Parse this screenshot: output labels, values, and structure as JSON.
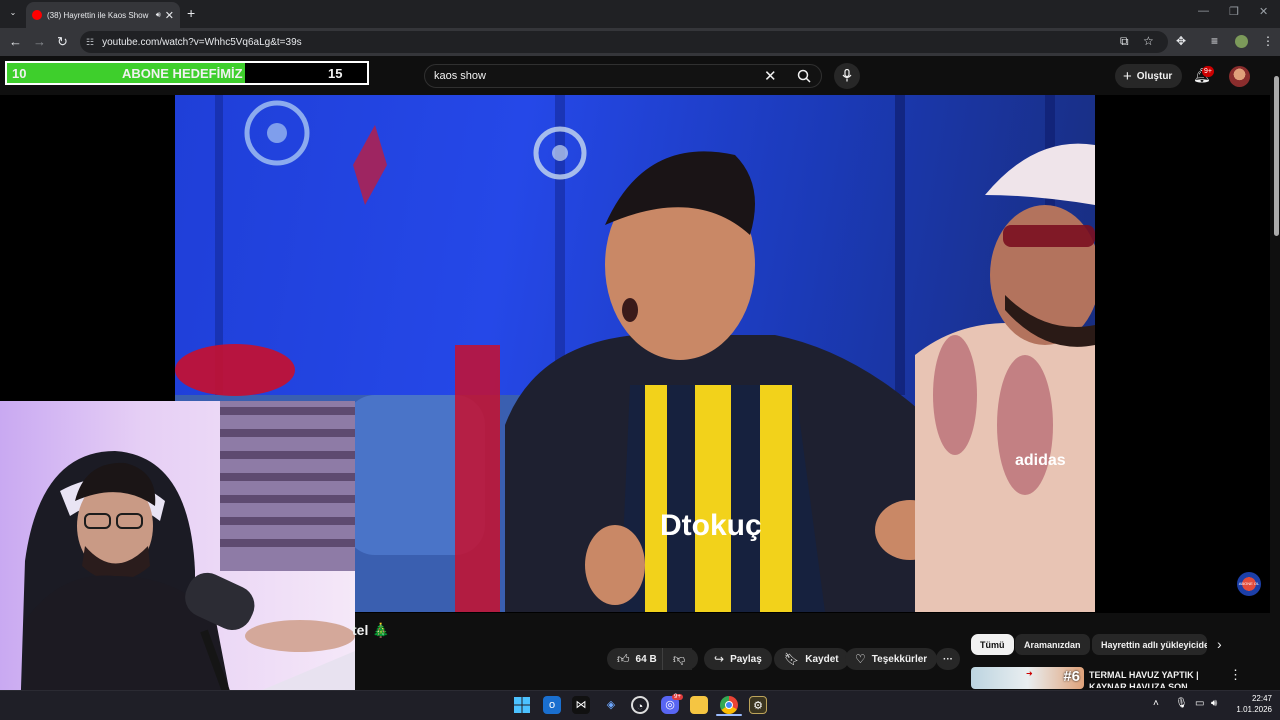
{
  "browser": {
    "tab_title": "(38) Hayrettin ile Kaos Show",
    "tab_audio_icon": "speaker-icon",
    "url": "youtube.com/watch?v=Whhc5Vq6aLg&t=39s"
  },
  "overlay": {
    "subscriber_goal": {
      "current": "10",
      "label": "ABONE HEDEFİMİZ",
      "target": "15",
      "progress_fraction": 0.66,
      "fill_color": "#3ecf2c"
    }
  },
  "youtube": {
    "search": {
      "value": "kaos show"
    },
    "header": {
      "create_label": "Oluştur",
      "notification_badge": "9+"
    },
    "video": {
      "title_visible_tail": "tel 🎄",
      "actions": {
        "likes": "64 B",
        "share": "Paylaş",
        "save": "Kaydet",
        "thanks": "Teşekkürler"
      }
    },
    "recommendations": {
      "chips": [
        "Tümü",
        "Aramanızdan",
        "Hayrettin adlı yükleyiciden"
      ],
      "active_chip": "Tümü",
      "items": [
        {
          "title": "TERMAL HAVUZ YAPTIK | KAYNAR HAVUZA SON DÜŞEN",
          "thumb_badge": "#6"
        }
      ]
    }
  },
  "video_frame": {
    "jersey_text": "Dtokuç",
    "cap_brand": "adidas",
    "channel_watermark": "ABONE OL"
  },
  "taskbar": {
    "time": "22:47",
    "date": "1.01.2026",
    "apps": [
      "windows-start-icon",
      "outlook-icon",
      "capcut-icon",
      "vpn-icon",
      "obs-icon",
      "discord-icon",
      "file-explorer-icon",
      "chrome-icon",
      "app-icon"
    ],
    "discord_badge": "9+"
  },
  "colors": {
    "youtube_bg": "#0f0f0f",
    "chrome_bg": "#202124",
    "accent_red": "#ff0000",
    "chip_active": "#f1f1f1"
  }
}
